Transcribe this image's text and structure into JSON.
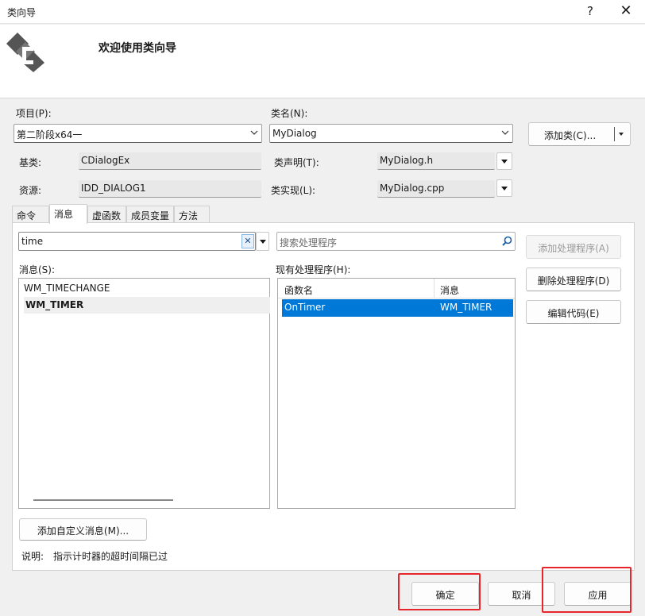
{
  "window": {
    "title": "类向导",
    "help": "?",
    "close": "✕"
  },
  "banner": {
    "heading": "欢迎使用类向导",
    "icon": "class-wizard-icon"
  },
  "project": {
    "label": "项目(P):",
    "value": "第二阶段x64一"
  },
  "classname": {
    "label": "类名(N):",
    "value": "MyDialog"
  },
  "add_class_button": "添加类(C)...",
  "base_class": {
    "label": "基类:",
    "value": "CDialogEx"
  },
  "resource": {
    "label": "资源:",
    "value": "IDD_DIALOG1"
  },
  "class_decl": {
    "label": "类声明(T):",
    "value": "MyDialog.h"
  },
  "class_impl": {
    "label": "类实现(L):",
    "value": "MyDialog.cpp"
  },
  "tabs": [
    "命令",
    "消息",
    "虚函数",
    "成员变量",
    "方法"
  ],
  "active_tab": "消息",
  "filter": {
    "value": "time",
    "clear": "✕"
  },
  "handler_search": {
    "placeholder": "搜索处理程序"
  },
  "messages": {
    "label": "消息(S):",
    "items": [
      "WM_TIMECHANGE",
      "WM_TIMER"
    ],
    "selected": "WM_TIMER"
  },
  "handlers": {
    "label": "现有处理程序(H):",
    "columns": [
      "函数名",
      "消息"
    ],
    "rows": [
      {
        "func": "OnTimer",
        "message": "WM_TIMER"
      }
    ]
  },
  "actions": {
    "add_handler": "添加处理程序(A)",
    "delete_handler": "删除处理程序(D)",
    "edit_code": "编辑代码(E)"
  },
  "add_custom_message": "添加自定义消息(M)...",
  "description": {
    "label": "说明:",
    "text": "指示计时器的超时间隔已过"
  },
  "footer": {
    "ok": "确定",
    "cancel": "取消",
    "apply": "应用"
  },
  "colors": {
    "selection": "#0078d7",
    "highlight_box": "#e8252b"
  }
}
